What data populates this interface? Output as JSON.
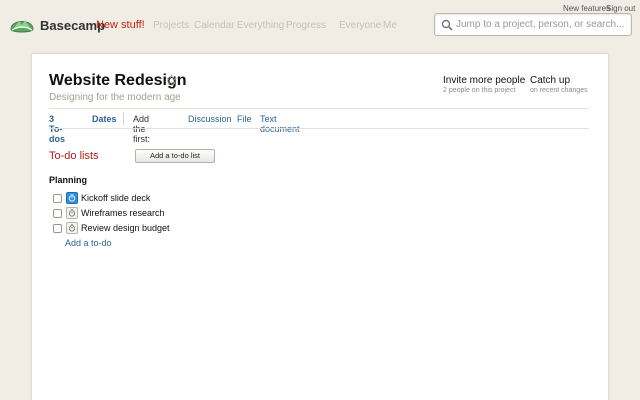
{
  "header": {
    "brand": "Basecamp",
    "new_stuff": "New stuff!",
    "nav": [
      "Projects",
      "Calendar",
      "Everything",
      "Progress",
      "Everyone",
      "Me"
    ],
    "utility_links": [
      "New features",
      "Sign out"
    ],
    "search_placeholder": "Jump to a project, person, or search..."
  },
  "project": {
    "title": "Website Redesign",
    "description": "Designing for the modern age",
    "invite": {
      "label": "Invite more people",
      "sub": "2 people on this project"
    },
    "catchup": {
      "label": "Catch up",
      "sub": "on recent changes"
    }
  },
  "tabs": {
    "todos": "3 To-dos",
    "dates": "Dates",
    "add_first": "Add the first:",
    "discussion": "Discussion",
    "file": "File",
    "text_document": "Text document"
  },
  "todo_section": {
    "title": "To-do lists",
    "add_button": "Add a to-do list",
    "list_title": "Planning",
    "items": [
      {
        "text": "Kickoff slide deck",
        "timer_active": true
      },
      {
        "text": "Wireframes research",
        "timer_active": false
      },
      {
        "text": "Review design budget",
        "timer_active": false
      }
    ],
    "add_todo": "Add a to-do"
  },
  "colors": {
    "background": "#f1ede4",
    "brand_red": "#c0251b",
    "section_red": "#a81d17",
    "link_blue": "#2a6496",
    "muted_tan": "#a89f8c",
    "timer_blue": "#2f8fe0"
  }
}
